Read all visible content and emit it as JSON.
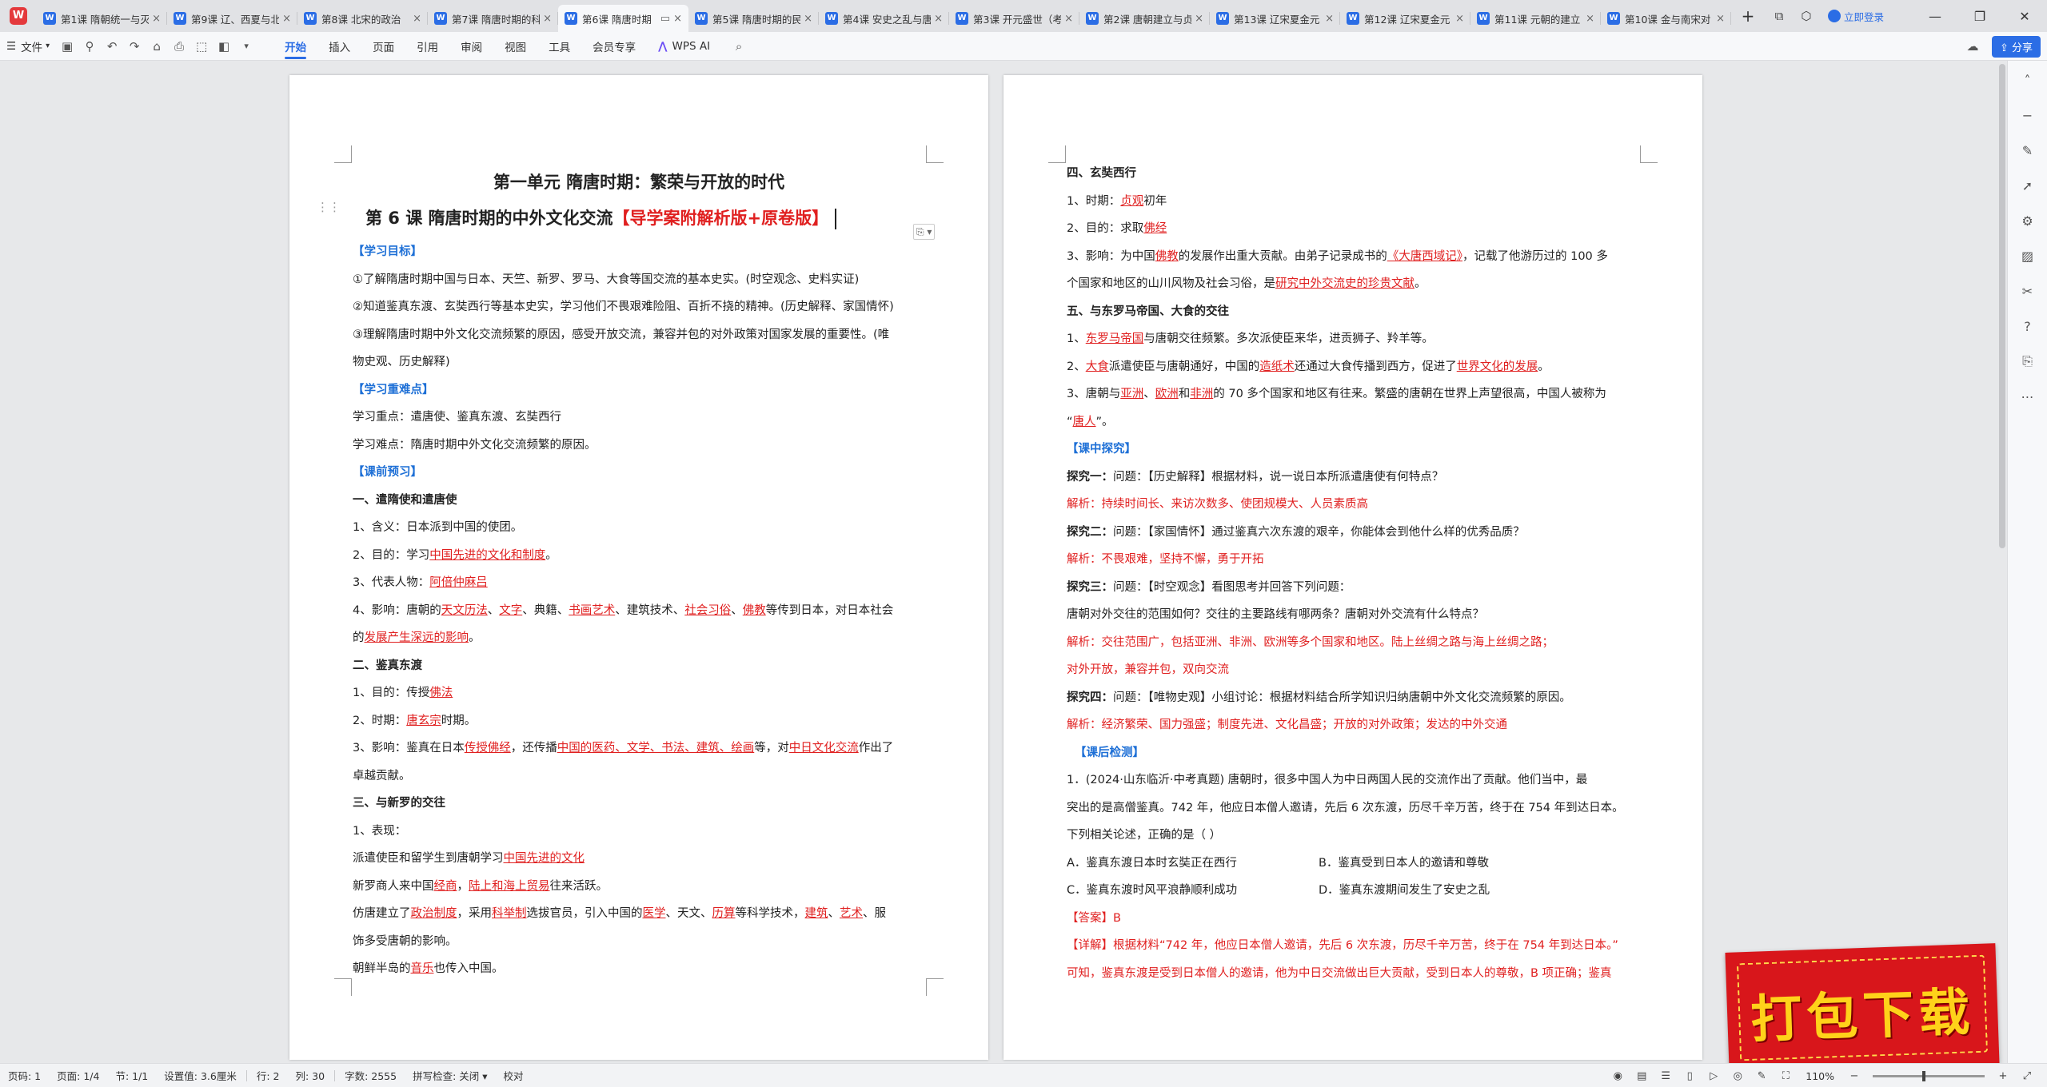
{
  "tabs": [
    {
      "label": "第1课 隋朝统一与灭亡",
      "active": false
    },
    {
      "label": "第9课 辽、西夏与北宋",
      "active": false
    },
    {
      "label": "第8课 北宋的政治",
      "active": false
    },
    {
      "label": "第7课 隋唐时期的科技",
      "active": false
    },
    {
      "label": "第6课 隋唐时期",
      "active": true
    },
    {
      "label": "第5课 隋唐时期的民族",
      "active": false
    },
    {
      "label": "第4课 安史之乱与唐",
      "active": false
    },
    {
      "label": "第3课 开元盛世（考",
      "active": false
    },
    {
      "label": "第2课 唐朝建立与贞",
      "active": false
    },
    {
      "label": "第13课 辽宋夏金元",
      "active": false
    },
    {
      "label": "第12课 辽宋夏金元",
      "active": false
    },
    {
      "label": "第11课 元朝的建立",
      "active": false
    },
    {
      "label": "第10课 金与南宋对",
      "active": false
    }
  ],
  "app": {
    "login": "立即登录",
    "share": "分享",
    "banner": "打包下载"
  },
  "ribbon": {
    "file": "文件",
    "tabs": [
      "开始",
      "插入",
      "页面",
      "引用",
      "审阅",
      "视图",
      "工具",
      "会员专享"
    ],
    "wps_ai": "WPS AI"
  },
  "page1": {
    "title1": "第一单元  隋唐时期：繁荣与开放的时代",
    "title2a": "第 6 课   隋唐时期的中外文化交流",
    "title2b": "【导学案附解析版+原卷版】",
    "goal_head": "【学习目标】",
    "g1": "①了解隋唐时期中国与日本、天竺、新罗、罗马、大食等国交流的基本史实。(时空观念、史料实证)",
    "g2": "②知道鉴真东渡、玄奘西行等基本史实，学习他们不畏艰难险阻、百折不挠的精神。(历史解释、家国情怀)",
    "g3a": "③理解隋唐时期中外文化交流频繁的原因，感受开放交流，兼容并包的对外政策对国家发展的重要性。(唯",
    "g3b": "物史观、历史解释)",
    "key_head": "【学习重难点】",
    "k1": "学习重点：遣唐使、鉴真东渡、玄奘西行",
    "k2": "学习难点：隋唐时期中外文化交流频繁的原因。",
    "pre_head": "【课前预习】",
    "s1": "一、遣隋使和遣唐使",
    "s1_1": "1、含义：日本派到中国的使团。",
    "s1_2a": "2、目的：学习",
    "s1_2b": "中国先进的文化和制度",
    "s1_2c": "。",
    "s1_3a": "3、代表人物：",
    "s1_3b": "阿倍仲麻吕",
    "s1_4a": "4、影响：唐朝的",
    "s1_4b": "天文历法",
    "s1_4c": "、",
    "s1_4d": "文字",
    "s1_4e": "、典籍、",
    "s1_4f": "书画艺术",
    "s1_4g": "、建筑技术、",
    "s1_4h": "社会习俗",
    "s1_4i": "、",
    "s1_4j": "佛教",
    "s1_4k": "等传到日本，对日本社会",
    "s1_4l": "的",
    "s1_4m": "发展产生深远的影响",
    "s1_4n": "。",
    "s2": "二、鉴真东渡",
    "s2_1a": "1、目的：传授",
    "s2_1b": "佛法",
    "s2_2a": "2、时期：",
    "s2_2b": "唐玄宗",
    "s2_2c": "时期。",
    "s2_3a": "3、影响：鉴真在日本",
    "s2_3b": "传授佛经",
    "s2_3c": "，还传播",
    "s2_3d": "中国的医药、文学、书法、建筑、绘画",
    "s2_3e": "等，对",
    "s2_3f": "中日文化交流",
    "s2_3g": "作出了",
    "s2_3h": "卓越贡献。",
    "s3": "三、与新罗的交往",
    "s3_1": "1、表现：",
    "s3_2a": "派遣使臣和留学生到唐朝学习",
    "s3_2b": "中国先进的文化",
    "s3_3a": "新罗商人来中国",
    "s3_3b": "经商",
    "s3_3c": "，",
    "s3_3d": "陆上和海上贸易",
    "s3_3e": "往来活跃。",
    "s3_4a": "仿唐建立了",
    "s3_4b": "政治制度",
    "s3_4c": "，采用",
    "s3_4d": "科举制",
    "s3_4e": "选拔官员，引入中国的",
    "s3_4f": "医学",
    "s3_4g": "、天文、",
    "s3_4h": "历算",
    "s3_4i": "等科学技术，",
    "s3_4j": "建筑",
    "s3_4k": "、",
    "s3_4l": "艺术",
    "s3_4m": "、服",
    "s3_5": "饰多受唐朝的影响。",
    "s3_6a": "朝鲜半岛的",
    "s3_6b": "音乐",
    "s3_6c": "也传入中国。"
  },
  "page2": {
    "s4": "四、玄奘西行",
    "s4_1a": "1、时期：",
    "s4_1b": "贞观",
    "s4_1c": "初年",
    "s4_2a": "2、目的：求取",
    "s4_2b": "佛经",
    "s4_3a": "3、影响：为中国",
    "s4_3b": "佛教",
    "s4_3c": "的发展作出重大贡献。由弟子记录成书的",
    "s4_3d": "《大唐西域记》",
    "s4_3e": "，记载了他游历过的 100 多",
    "s4_3f": "个国家和地区的山川风物及社会习俗，是",
    "s4_3g": "研究中外交流史的珍贵文献",
    "s4_3h": "。",
    "s5": "五、与东罗马帝国、大食的交往",
    "s5_1a": "1、",
    "s5_1b": "东罗马帝国",
    "s5_1c": "与唐朝交往频繁。多次派使臣来华，进贡狮子、羚羊等。",
    "s5_2a": "2、",
    "s5_2b": "大食",
    "s5_2c": "派遣使臣与唐朝通好，中国的",
    "s5_2d": "造纸术",
    "s5_2e": "还通过大食传播到西方，促进了",
    "s5_2f": "世界文化的发展",
    "s5_2g": "。",
    "s5_3a": "3、唐朝与",
    "s5_3b": "亚洲",
    "s5_3c": "、",
    "s5_3d": "欧洲",
    "s5_3e": "和",
    "s5_3f": "非洲",
    "s5_3g": "的 70 多个国家和地区有往来。繁盛的唐朝在世界上声望很高，中国人被称为",
    "s5_4a": "“",
    "s5_4b": "唐人",
    "s5_4c": "”。",
    "mid_head": "【课中探究】",
    "q1a": "探究一：",
    "q1b": "问题：【历史解释】根据材料，说一说日本所派遣唐使有何特点？",
    "a1": "解析：持续时间长、来访次数多、使团规模大、人员素质高",
    "q2a": "探究二：",
    "q2b": "问题：【家国情怀】通过鉴真六次东渡的艰辛，你能体会到他什么样的优秀品质？",
    "a2": "解析：不畏艰难，坚持不懈，勇于开拓",
    "q3a": "探究三：",
    "q3b": "问题：【时空观念】看图思考并回答下列问题：",
    "q3c": "唐朝对外交往的范围如何？交往的主要路线有哪两条？唐朝对外交流有什么特点？",
    "a3a": "解析：交往范围广，包括亚洲、非洲、欧洲等多个国家和地区。陆上丝绸之路与海上丝绸之路；",
    "a3b": "对外开放，兼容并包，双向交流",
    "q4a": "探究四：",
    "q4b": "问题：【唯物史观】小组讨论：根据材料结合所学知识归纳唐朝中外文化交流频繁的原因。",
    "a4": "解析：经济繁荣、国力强盛；制度先进、文化昌盛；开放的对外政策；发达的中外交通",
    "post_head": "【课后检测】",
    "t1a": "1．(2024·山东临沂·中考真题) 唐朝时，很多中国人为中日两国人民的交流作出了贡献。他们当中，最",
    "t1b": "突出的是高僧鉴真。742 年，他应日本僧人邀请，先后 6 次东渡，历尽千辛万苦，终于在 754 年到达日本。",
    "t1c": "下列相关论述，正确的是（          ）",
    "oA": "A．鉴真东渡日本时玄奘正在西行",
    "oB": "B．鉴真受到日本人的邀请和尊敬",
    "oC": "C．鉴真东渡时风平浪静顺利成功",
    "oD": "D．鉴真东渡期间发生了安史之乱",
    "ans": "【答案】B",
    "det1": "【详解】根据材料“742 年，他应日本僧人邀请，先后 6 次东渡，历尽千辛万苦，终于在 754 年到达日本。”",
    "det2": "可知，鉴真东渡是受到日本僧人的邀请，他为中日交流做出巨大贡献，受到日本人的尊敬，B 项正确；鉴真"
  },
  "status": {
    "page_no": "页码: 1",
    "pages": "页面: 1/4",
    "section": "节: 1/1",
    "setting": "设置值: 3.6厘米",
    "row": "行: 2",
    "col": "列: 30",
    "words": "字数: 2555",
    "spell": "拼写检查: 关闭",
    "proof": "校对",
    "zoom": "110%"
  }
}
